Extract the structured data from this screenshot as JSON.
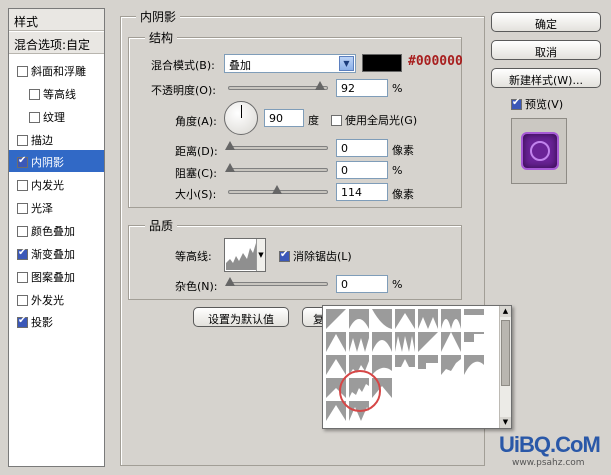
{
  "style_list": {
    "header": "样式",
    "blend_options": "混合选项:自定",
    "items": [
      {
        "label": "斜面和浮雕",
        "checked": false,
        "indent": false,
        "selected": false
      },
      {
        "label": "等高线",
        "checked": false,
        "indent": true,
        "selected": false
      },
      {
        "label": "纹理",
        "checked": false,
        "indent": true,
        "selected": false
      },
      {
        "label": "描边",
        "checked": false,
        "indent": false,
        "selected": false
      },
      {
        "label": "内阴影",
        "checked": true,
        "indent": false,
        "selected": true
      },
      {
        "label": "内发光",
        "checked": false,
        "indent": false,
        "selected": false
      },
      {
        "label": "光泽",
        "checked": false,
        "indent": false,
        "selected": false
      },
      {
        "label": "颜色叠加",
        "checked": false,
        "indent": false,
        "selected": false
      },
      {
        "label": "渐变叠加",
        "checked": true,
        "indent": false,
        "selected": false
      },
      {
        "label": "图案叠加",
        "checked": false,
        "indent": false,
        "selected": false
      },
      {
        "label": "外发光",
        "checked": false,
        "indent": false,
        "selected": false
      },
      {
        "label": "投影",
        "checked": true,
        "indent": false,
        "selected": false
      }
    ]
  },
  "panel": {
    "title": "内阴影",
    "structure": {
      "title": "结构",
      "blend_mode_label": "混合模式(B):",
      "blend_mode_value": "叠加",
      "color_hex": "#000000",
      "opacity_label": "不透明度(O):",
      "opacity_value": "92",
      "opacity_unit": "%",
      "angle_label": "角度(A):",
      "angle_value": "90",
      "angle_unit": "度",
      "global_light_label": "使用全局光(G)",
      "global_light_checked": false,
      "distance_label": "距离(D):",
      "distance_value": "0",
      "distance_unit": "像素",
      "choke_label": "阻塞(C):",
      "choke_value": "0",
      "choke_unit": "%",
      "size_label": "大小(S):",
      "size_value": "114",
      "size_unit": "像素"
    },
    "quality": {
      "title": "品质",
      "contour_label": "等高线:",
      "antialias_label": "消除锯齿(L)",
      "antialias_checked": true,
      "noise_label": "杂色(N):",
      "noise_value": "0",
      "noise_unit": "%"
    },
    "set_default_label": "设置为默认值",
    "reset_default_label_partial": "复"
  },
  "buttons": {
    "ok": "确定",
    "cancel": "取消",
    "new_style": "新建样式(W)...",
    "preview_label": "预览(V)",
    "preview_checked": true
  },
  "watermark": {
    "main": "UiBQ.CoM",
    "sub": "www.psahz.com"
  },
  "colors": {
    "selected_bg": "#3169c6",
    "preview_fill": "#6b2398",
    "hex_text": "#a81e1e",
    "highlight_ring": "#d64646"
  }
}
